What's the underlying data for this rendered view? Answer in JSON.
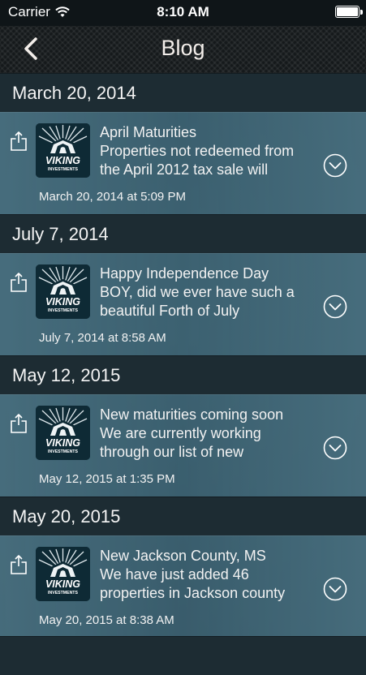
{
  "status": {
    "carrier": "Carrier",
    "time": "8:10 AM"
  },
  "nav": {
    "title": "Blog"
  },
  "sections": [
    {
      "date": "March 20, 2014",
      "title": "April Maturities",
      "line1": "Properties not redeemed from",
      "line2": "the April 2012 tax sale will",
      "timestamp": "March 20, 2014 at 5:09 PM"
    },
    {
      "date": "July 7, 2014",
      "title": "Happy Independence Day",
      "line1": "BOY, did we ever have such a",
      "line2": "beautiful Forth of July",
      "timestamp": "July 7, 2014 at 8:58 AM"
    },
    {
      "date": "May 12, 2015",
      "title": "New maturities coming soon",
      "line1": "We are currently working",
      "line2": "through our list of new",
      "timestamp": "May 12, 2015 at 1:35 PM"
    },
    {
      "date": "May 20, 2015",
      "title": "New Jackson County, MS",
      "line1": "We have just added 46",
      "line2": "properties in Jackson county",
      "timestamp": "May 20, 2015 at 8:38 AM"
    }
  ],
  "logo": {
    "word1": "VIKING",
    "word2": "INVESTMENTS"
  },
  "icons": {
    "back": "chevron-left-icon",
    "share": "share-icon",
    "expand": "chevron-down-circle-icon",
    "wifi": "wifi-icon",
    "battery": "battery-icon"
  }
}
